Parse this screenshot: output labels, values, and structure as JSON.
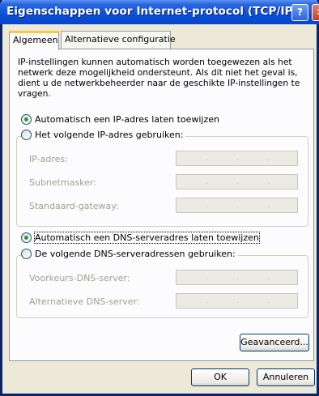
{
  "window": {
    "title": "Eigenschappen voor Internet-protocol (TCP/IP)",
    "help_glyph": "?",
    "close_glyph": "✕"
  },
  "tabs": [
    {
      "label": "Algemeen",
      "active": true
    },
    {
      "label": "Alternatieve configuratie",
      "active": false
    }
  ],
  "description": "IP-instellingen kunnen automatisch worden toegewezen als het netwerk deze mogelijkheid ondersteunt. Als dit niet het geval is, dient u de netwerkbeheerder naar de geschikte IP-instellingen te vragen.",
  "ip": {
    "auto_label": "Automatisch een IP-adres laten toewijzen",
    "auto_checked": true,
    "manual_label": "Het volgende IP-adres gebruiken:",
    "manual_checked": false,
    "fields": [
      {
        "label": "IP-adres:"
      },
      {
        "label": "Subnetmasker:"
      },
      {
        "label": "Standaard-gateway:"
      }
    ]
  },
  "dns": {
    "auto_label": "Automatisch een DNS-serveradres laten toewijzen",
    "auto_checked": true,
    "manual_label": "De volgende DNS-serveradressen gebruiken:",
    "manual_checked": false,
    "fields": [
      {
        "label": "Voorkeurs-DNS-server:"
      },
      {
        "label": "Alternatieve DNS-server:"
      }
    ]
  },
  "buttons": {
    "advanced": "Geavanceerd...",
    "ok": "OK",
    "cancel": "Annuleren"
  },
  "colors": {
    "titlebar": "#0a4fd8",
    "window_bg": "#ece9d8",
    "panel_bg": "#fcfcfe",
    "radio_dot": "#21a121",
    "tab_highlight": "#ffc73c"
  }
}
